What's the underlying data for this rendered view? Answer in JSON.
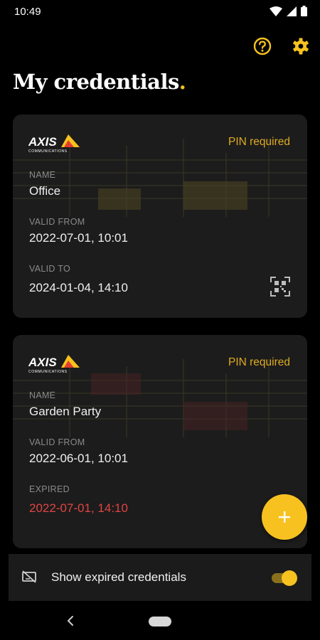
{
  "status_bar": {
    "time": "10:49"
  },
  "header": {
    "title": "My credentials",
    "title_dot": ".",
    "help_icon": "help-circle-icon",
    "settings_icon": "gear-icon"
  },
  "credentials": [
    {
      "brand": "AXIS",
      "brand_sub": "COMMUNICATIONS",
      "badge": "PIN required",
      "name_label": "NAME",
      "name": "Office",
      "from_label": "VALID FROM",
      "from": "2022-07-01, 10:01",
      "to_label": "VALID TO",
      "to": "2024-01-04, 14:10",
      "expired": false,
      "qr_icon": "qr-code-icon"
    },
    {
      "brand": "AXIS",
      "brand_sub": "COMMUNICATIONS",
      "badge": "PIN required",
      "name_label": "NAME",
      "name": "Garden Party",
      "from_label": "VALID FROM",
      "from": "2022-06-01, 10:01",
      "to_label": "EXPIRED",
      "to": "2022-07-01, 14:10",
      "expired": true
    }
  ],
  "fab": {
    "icon": "plus-icon"
  },
  "footer": {
    "icon": "expired-credential-icon",
    "label": "Show expired credentials",
    "toggle_on": true
  },
  "colors": {
    "accent": "#f7c21f",
    "badge": "#e0ab21",
    "expired": "#e24343",
    "card": "#1c1c1c",
    "background": "#000000"
  }
}
